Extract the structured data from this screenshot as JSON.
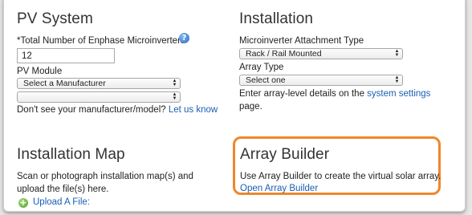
{
  "pv_system": {
    "title": "PV System",
    "microinverters_label": "*Total Number of Enphase Microinverters",
    "microinverters_value": "12",
    "help_icon_glyph": "?",
    "pv_module_label": "PV Module",
    "manufacturer_select": "Select a Manufacturer",
    "model_select": "",
    "missing_prompt": "Don't see your manufacturer/model?",
    "let_us_know_link": "Let us know"
  },
  "installation": {
    "title": "Installation",
    "attachment_label": "Microinverter Attachment Type",
    "attachment_select": "Rack / Rail Mounted",
    "array_type_label": "Array Type",
    "array_type_select": "Select one",
    "details_prefix": "Enter array-level details on the",
    "details_link": "system settings",
    "details_suffix": "page."
  },
  "installation_map": {
    "title": "Installation Map",
    "description_line1": "Scan or photograph installation map(s) and",
    "description_line2": "upload the file(s) here.",
    "upload_link": "Upload A File:",
    "upload_icon_glyph": "+"
  },
  "array_builder": {
    "title": "Array Builder",
    "description": "Use Array Builder to create the virtual solar array.",
    "open_link": "Open Array Builder",
    "highlight_color": "#f0862a"
  },
  "colors": {
    "link": "#1a5fb4",
    "accent": "#f0862a"
  },
  "icons": {
    "help": "help-circle-icon",
    "upload": "upload-plus-icon",
    "select_arrows": "up-down-arrows-icon"
  }
}
